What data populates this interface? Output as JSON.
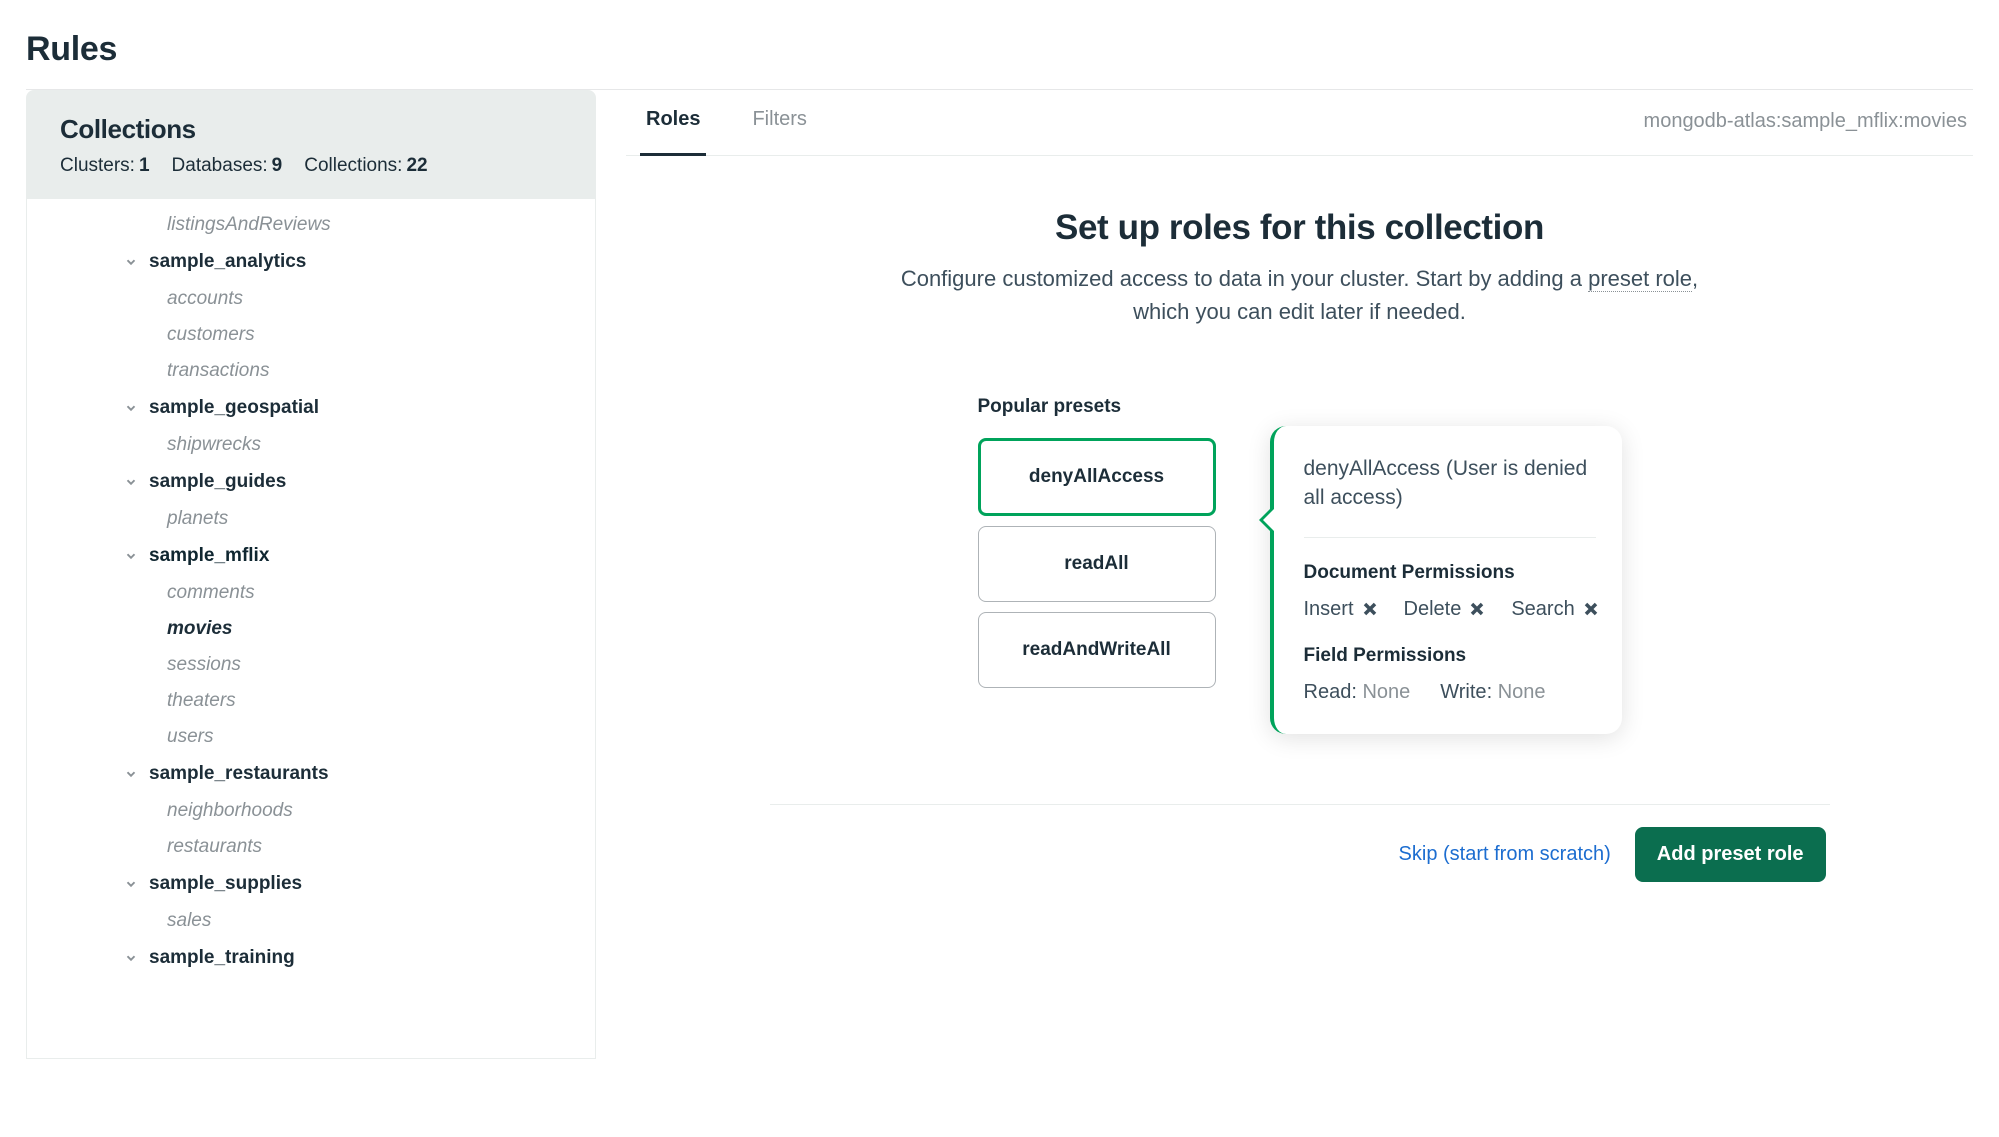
{
  "page": {
    "title": "Rules"
  },
  "sidebar": {
    "title": "Collections",
    "stats": {
      "clusters_label": "Clusters:",
      "clusters": "1",
      "databases_label": "Databases:",
      "databases": "9",
      "collections_label": "Collections:",
      "collections": "22"
    },
    "orphan_collection": "listingsAndReviews",
    "databases": [
      {
        "name": "sample_analytics",
        "collections": [
          "accounts",
          "customers",
          "transactions"
        ]
      },
      {
        "name": "sample_geospatial",
        "collections": [
          "shipwrecks"
        ]
      },
      {
        "name": "sample_guides",
        "collections": [
          "planets"
        ]
      },
      {
        "name": "sample_mflix",
        "selected": true,
        "collections": [
          "comments",
          "movies",
          "sessions",
          "theaters",
          "users"
        ],
        "selected_collection": "movies"
      },
      {
        "name": "sample_restaurants",
        "collections": [
          "neighborhoods",
          "restaurants"
        ]
      },
      {
        "name": "sample_supplies",
        "collections": [
          "sales"
        ]
      },
      {
        "name": "sample_training",
        "collections": []
      }
    ]
  },
  "tabs": {
    "roles": "Roles",
    "filters": "Filters"
  },
  "breadcrumb": "mongodb-atlas:sample_mflix:movies",
  "main": {
    "title": "Set up roles for this collection",
    "subtitle_a": "Configure customized access to data in your cluster. Start by adding a ",
    "subtitle_link": "preset role",
    "subtitle_b": ", which you can edit later if needed."
  },
  "presets": {
    "label": "Popular presets",
    "options": [
      "denyAllAccess",
      "readAll",
      "readAndWriteAll"
    ]
  },
  "info": {
    "title": "denyAllAccess (User is denied all access)",
    "doc_perm_title": "Document Permissions",
    "doc_perms": [
      "Insert",
      "Delete",
      "Search"
    ],
    "field_perm_title": "Field Permissions",
    "read_label": "Read",
    "read_value": "None",
    "write_label": "Write",
    "write_value": "None"
  },
  "actions": {
    "skip": "Skip (start from scratch)",
    "add": "Add preset role"
  }
}
